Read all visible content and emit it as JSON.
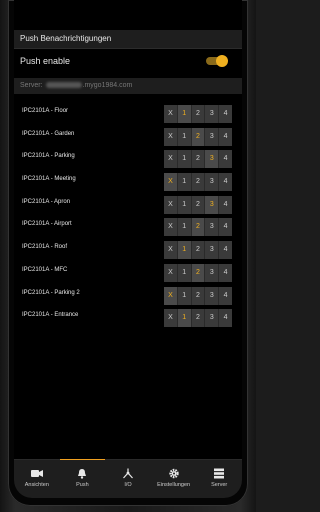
{
  "header": {
    "title": "Push Benachrichtigungen"
  },
  "push": {
    "label": "Push enable",
    "enabled": true,
    "accent": "#f0b020"
  },
  "server": {
    "prefix": "Server: ",
    "suffix": ".mygo1984.com"
  },
  "rows": [
    {
      "label": "IPC2101A - Floor",
      "options": [
        "X",
        "1",
        "2",
        "3",
        "4"
      ],
      "selected": "1"
    },
    {
      "label": "IPC2101A - Garden",
      "options": [
        "X",
        "1",
        "2",
        "3",
        "4"
      ],
      "selected": "2"
    },
    {
      "label": "IPC2101A - Parking",
      "options": [
        "X",
        "1",
        "2",
        "3",
        "4"
      ],
      "selected": "3"
    },
    {
      "label": "IPC2101A - Meeting",
      "options": [
        "X",
        "1",
        "2",
        "3",
        "4"
      ],
      "selected": "X"
    },
    {
      "label": "IPC2101A - Apron",
      "options": [
        "X",
        "1",
        "2",
        "3",
        "4"
      ],
      "selected": "3"
    },
    {
      "label": "IPC2101A - Airport",
      "options": [
        "X",
        "1",
        "2",
        "3",
        "4"
      ],
      "selected": "2"
    },
    {
      "label": "IPC2101A - Roof",
      "options": [
        "X",
        "1",
        "2",
        "3",
        "4"
      ],
      "selected": "1"
    },
    {
      "label": "IPC2101A - MFC",
      "options": [
        "X",
        "1",
        "2",
        "3",
        "4"
      ],
      "selected": "2"
    },
    {
      "label": "IPC2101A - Parking 2",
      "options": [
        "X",
        "1",
        "2",
        "3",
        "4"
      ],
      "selected": "X"
    },
    {
      "label": "IPC2101A - Entrance",
      "options": [
        "X",
        "1",
        "2",
        "3",
        "4"
      ],
      "selected": "1"
    }
  ],
  "nav": [
    {
      "label": "Ansichten",
      "icon": "camera-icon",
      "active": false
    },
    {
      "label": "Push",
      "icon": "bell-icon",
      "active": true
    },
    {
      "label": "I/O",
      "icon": "io-icon",
      "active": false
    },
    {
      "label": "Einstellungen",
      "icon": "gear-icon",
      "active": false
    },
    {
      "label": "Server",
      "icon": "server-icon",
      "active": false
    }
  ]
}
